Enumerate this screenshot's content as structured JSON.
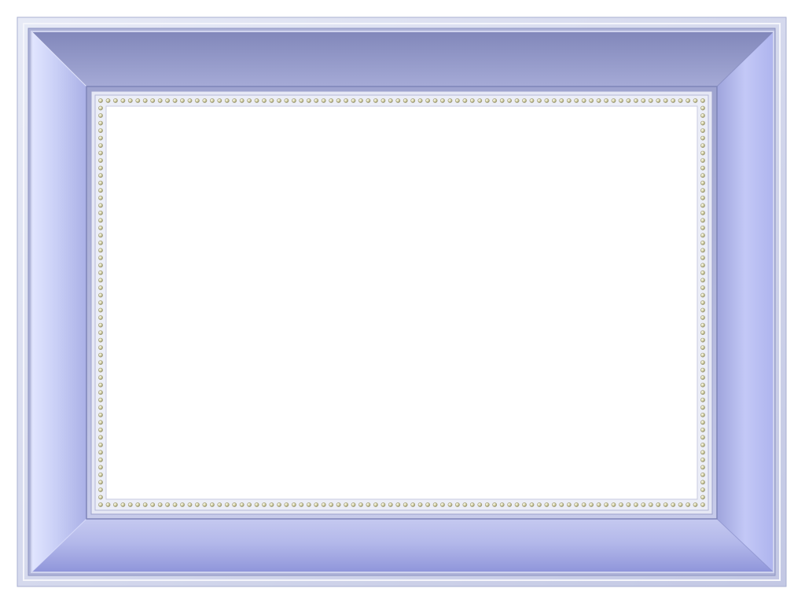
{
  "frame": {
    "style": "beveled picture frame with beaded inner border",
    "colors": {
      "outer_rim": "#c9cfe6",
      "outer_rim_edge": "#9aa0c8",
      "bevel_top": "#8c91bd",
      "bevel_left": "#d8ddfb",
      "bevel_right": "#b6bcee",
      "bevel_bottom": "#a9aee3",
      "inner_lip": "#b9bfe0",
      "bead_band": "#e9ebf6",
      "bead": "#d6d2a2",
      "bead_outline": "#8f8c6a",
      "picture_area": "#ffffff"
    },
    "picture_area_empty": true
  }
}
